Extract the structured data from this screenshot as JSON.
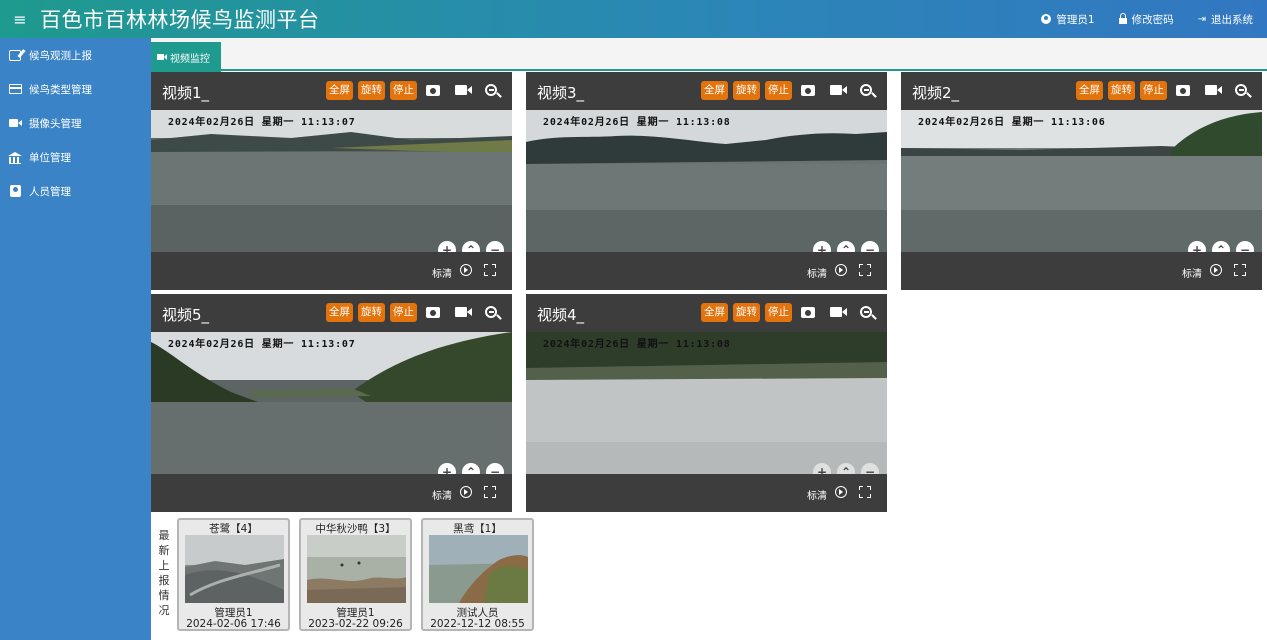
{
  "header": {
    "title": "百色市百林林场候鸟监测平台",
    "menu_icon": "≡",
    "user": "管理员1",
    "change_password": "修改密码",
    "logout": "退出系统"
  },
  "sidebar": {
    "items": [
      {
        "label": "候鸟观测上报",
        "icon": "edit-icon"
      },
      {
        "label": "候鸟类型管理",
        "icon": "card-icon"
      },
      {
        "label": "摄像头管理",
        "icon": "camera-icon"
      },
      {
        "label": "单位管理",
        "icon": "bank-icon"
      },
      {
        "label": "人员管理",
        "icon": "user-card-icon"
      }
    ]
  },
  "tab": {
    "label": "视频监控"
  },
  "panel_controls": {
    "fullscreen": "全屏",
    "rotate": "旋转",
    "stop": "停止",
    "quality": "标清",
    "zoom_in": "+",
    "up": "⌃",
    "zoom_out": "−",
    "left": "‹",
    "down": "⌄",
    "right": "›"
  },
  "videos": [
    {
      "title": "视频1_",
      "osd": "2024年02月26日  星期一  11:13:07"
    },
    {
      "title": "视频3_",
      "osd": "2024年02月26日  星期一  11:13:08"
    },
    {
      "title": "视频2_",
      "osd": "2024年02月26日  星期一  11:13:06"
    },
    {
      "title": "视频5_",
      "osd": "2024年02月26日  星期一  11:13:07"
    },
    {
      "title": "视频4_",
      "osd": "2024年02月26日  星期一  11:13:08"
    }
  ],
  "latest": {
    "label": "最新上报情况",
    "cards": [
      {
        "name": "苍鹭【4】",
        "by": "管理员1",
        "time": "2024-02-06 17:46"
      },
      {
        "name": "中华秋沙鸭【3】",
        "by": "管理员1",
        "time": "2023-02-22 09:26"
      },
      {
        "name": "黑鸢【1】",
        "by": "测试人员",
        "time": "2022-12-12 08:55"
      }
    ]
  },
  "colors": {
    "header_start": "#1e9a8e",
    "header_end": "#3277c2",
    "sidebar": "#3a83c6",
    "tab_active": "#1e9a8e",
    "action_button": "#e2730d",
    "panel_bg": "#3d3d3d"
  }
}
